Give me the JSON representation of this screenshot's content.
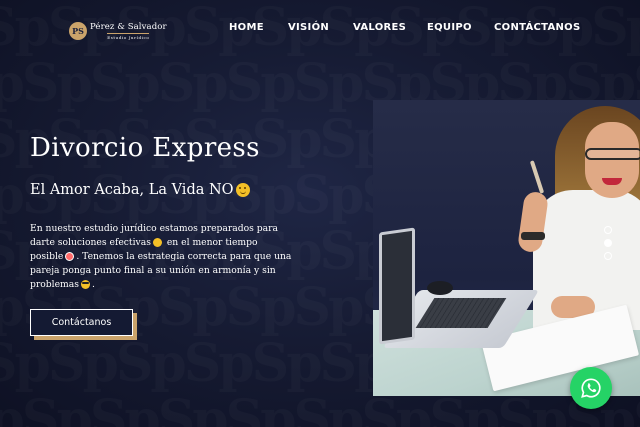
{
  "brand": {
    "monogram": "PS",
    "name": "Pérez & Salvador",
    "tagline": "Estudio Jurídico"
  },
  "nav": {
    "items": [
      {
        "label": "HOME"
      },
      {
        "label": "VISIÓN"
      },
      {
        "label": "VALORES"
      },
      {
        "label": "EQUIPO"
      },
      {
        "label": "CONTÁCTANOS"
      }
    ]
  },
  "hero": {
    "title": "Divorcio Express",
    "subtitle": "El Amor Acaba, La Vida NO",
    "subtitle_emoji": "winking-face",
    "body_lines": [
      "En nuestro estudio jurídico estamos preparados para",
      "darte soluciones efectivas",
      "en el menor tiempo",
      "posible",
      ". Tenemos la estrategia correcta para que una",
      "pareja ponga punto final a su unión en armonía y sin",
      "problemas",
      "."
    ],
    "cta_label": "Contáctanos"
  },
  "slider": {
    "slide_count": 3,
    "active_index": 1
  },
  "colors": {
    "background": "#161b33",
    "accent": "#caa36a",
    "whatsapp": "#25d366"
  },
  "icons": {
    "whatsapp": "whatsapp-icon",
    "emoji_subtitle": "wink-emoji-icon",
    "emoji_smile": "smile-emoji-icon",
    "emoji_clock": "alarm-clock-emoji-icon",
    "emoji_cool": "sunglasses-emoji-icon"
  }
}
